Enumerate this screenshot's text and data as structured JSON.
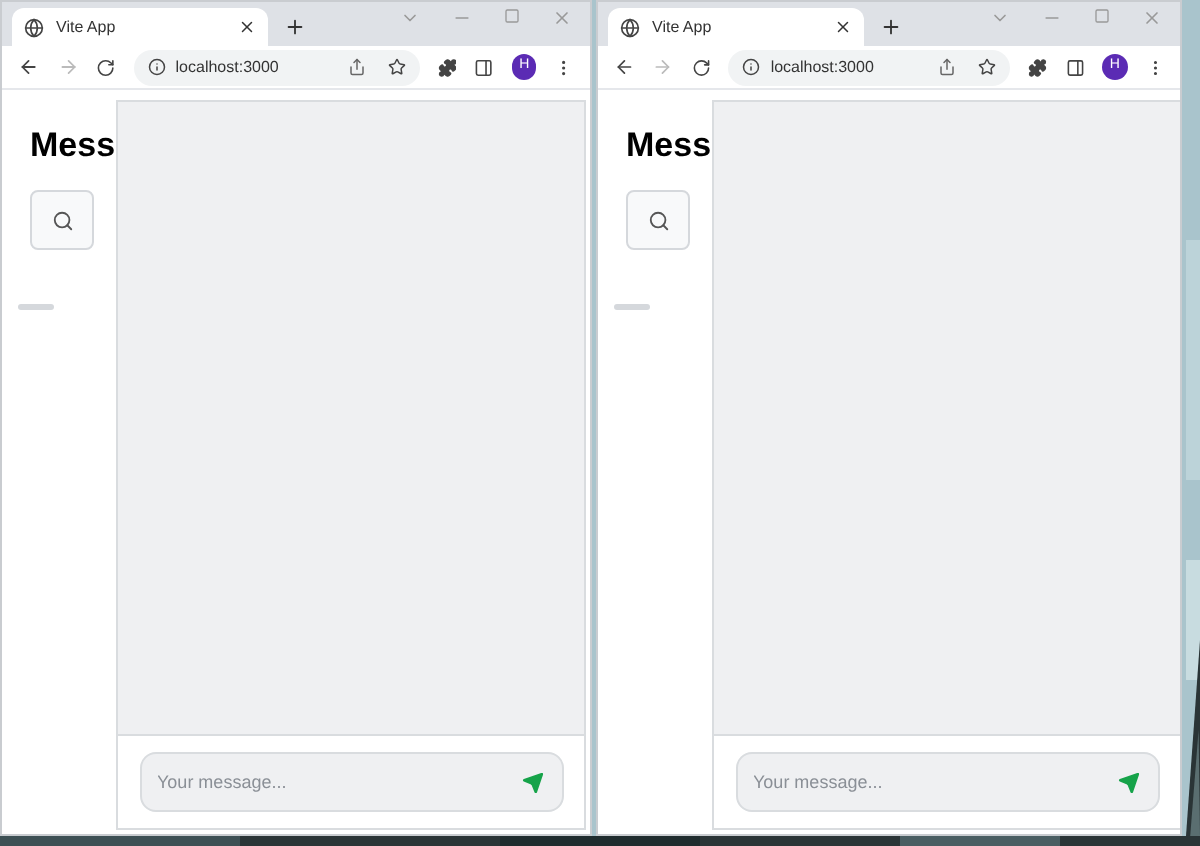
{
  "windows": [
    {
      "tab": {
        "title": "Vite App"
      },
      "address": "localhost:3000",
      "avatar": "H",
      "page": {
        "heading": "Mess",
        "message_input": {
          "placeholder": "Your message..."
        }
      }
    },
    {
      "tab": {
        "title": "Vite App"
      },
      "address": "localhost:3000",
      "avatar": "H",
      "page": {
        "heading": "Mess",
        "message_input": {
          "placeholder": "Your message..."
        }
      }
    }
  ]
}
